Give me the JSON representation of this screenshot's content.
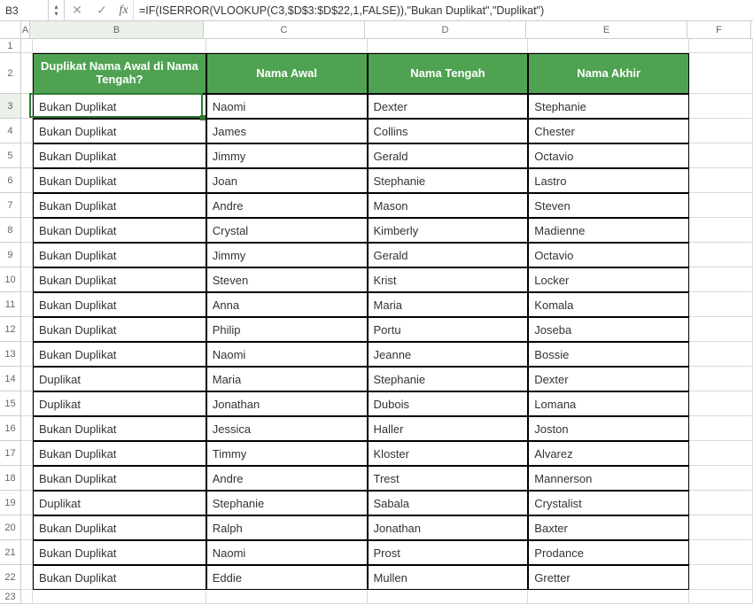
{
  "namebox": "B3",
  "formula": "=IF(ISERROR(VLOOKUP(C3,$D$3:$D$22,1,FALSE)),\"Bukan Duplikat\",\"Duplikat\")",
  "fx_label": "fx",
  "columns": {
    "A": "A",
    "B": "B",
    "C": "C",
    "D": "D",
    "E": "E",
    "F": "F"
  },
  "row_labels": [
    "1",
    "2",
    "3",
    "4",
    "5",
    "6",
    "7",
    "8",
    "9",
    "10",
    "11",
    "12",
    "13",
    "14",
    "15",
    "16",
    "17",
    "18",
    "19",
    "20",
    "21",
    "22",
    "23"
  ],
  "headers": {
    "B": "Duplikat Nama Awal di Nama Tengah?",
    "C": "Nama Awal",
    "D": "Nama Tengah",
    "E": "Nama Akhir"
  },
  "rows": [
    {
      "b": "Bukan Duplikat",
      "c": "Naomi",
      "d": "Dexter",
      "e": "Stephanie"
    },
    {
      "b": "Bukan Duplikat",
      "c": "James",
      "d": "Collins",
      "e": "Chester"
    },
    {
      "b": "Bukan Duplikat",
      "c": "Jimmy",
      "d": "Gerald",
      "e": "Octavio"
    },
    {
      "b": "Bukan Duplikat",
      "c": "Joan",
      "d": "Stephanie",
      "e": "Lastro"
    },
    {
      "b": "Bukan Duplikat",
      "c": "Andre",
      "d": "Mason",
      "e": "Steven"
    },
    {
      "b": "Bukan Duplikat",
      "c": "Crystal",
      "d": "Kimberly",
      "e": "Madienne"
    },
    {
      "b": "Bukan Duplikat",
      "c": "Jimmy",
      "d": "Gerald",
      "e": "Octavio"
    },
    {
      "b": "Bukan Duplikat",
      "c": "Steven",
      "d": "Krist",
      "e": "Locker"
    },
    {
      "b": "Bukan Duplikat",
      "c": "Anna",
      "d": "Maria",
      "e": "Komala"
    },
    {
      "b": "Bukan Duplikat",
      "c": "Philip",
      "d": "Portu",
      "e": "Joseba"
    },
    {
      "b": "Bukan Duplikat",
      "c": "Naomi",
      "d": "Jeanne",
      "e": "Bossie"
    },
    {
      "b": "Duplikat",
      "c": "Maria",
      "d": "Stephanie",
      "e": "Dexter"
    },
    {
      "b": "Duplikat",
      "c": "Jonathan",
      "d": "Dubois",
      "e": "Lomana"
    },
    {
      "b": "Bukan Duplikat",
      "c": "Jessica",
      "d": "Haller",
      "e": "Joston"
    },
    {
      "b": "Bukan Duplikat",
      "c": "Timmy",
      "d": "Kloster",
      "e": "Alvarez"
    },
    {
      "b": "Bukan Duplikat",
      "c": "Andre",
      "d": "Trest",
      "e": "Mannerson"
    },
    {
      "b": "Duplikat",
      "c": "Stephanie",
      "d": "Sabala",
      "e": "Crystalist"
    },
    {
      "b": "Bukan Duplikat",
      "c": "Ralph",
      "d": "Jonathan",
      "e": "Baxter"
    },
    {
      "b": "Bukan Duplikat",
      "c": "Naomi",
      "d": "Prost",
      "e": "Prodance"
    },
    {
      "b": "Bukan Duplikat",
      "c": "Eddie",
      "d": "Mullen",
      "e": "Gretter"
    }
  ],
  "icons": {
    "up": "▴",
    "down": "▾",
    "cancel": "✕",
    "confirm": "✓"
  }
}
